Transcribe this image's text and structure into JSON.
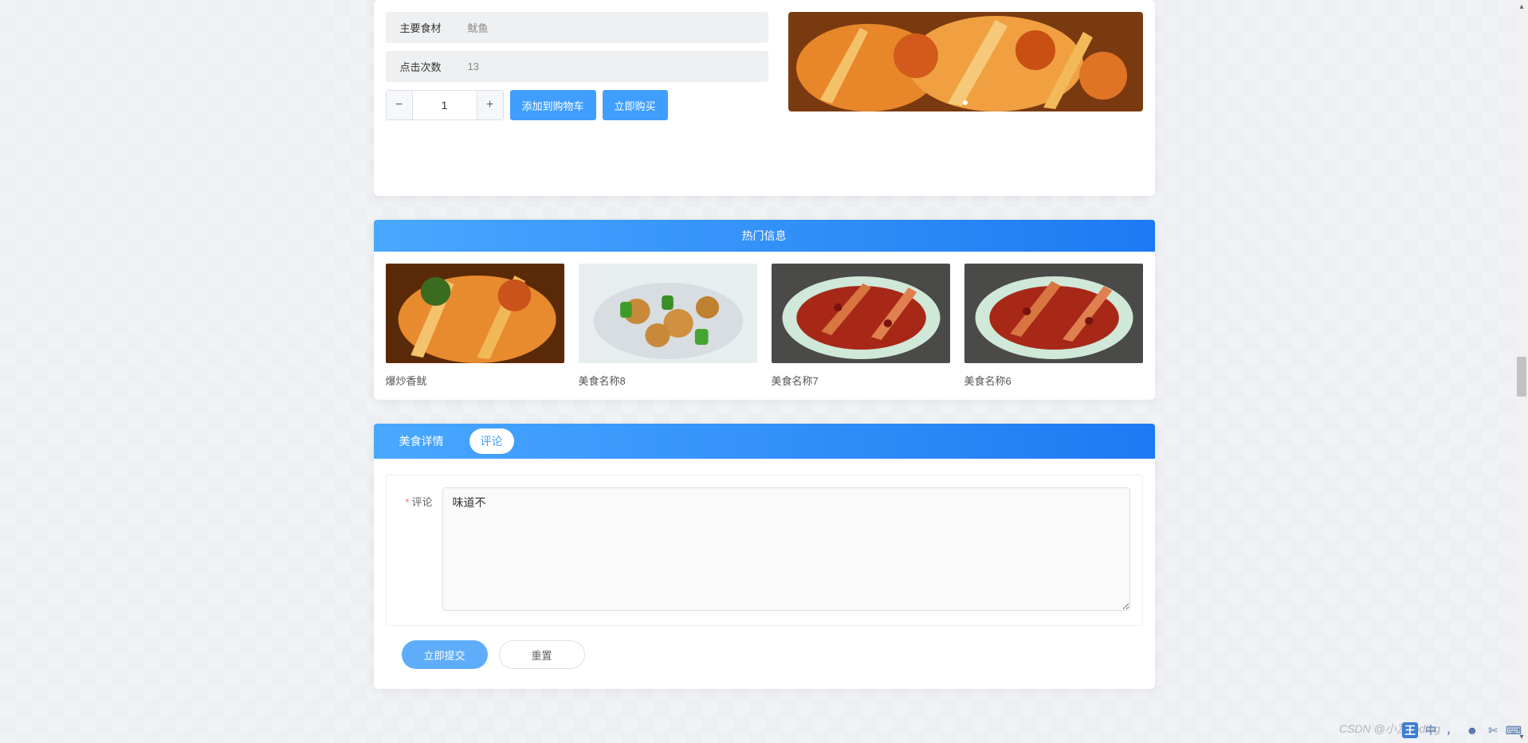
{
  "detail": {
    "ingredient_label": "主要食材",
    "ingredient_value": "鱿鱼",
    "clicks_label": "点击次数",
    "clicks_value": "13",
    "qty": "1",
    "add_cart": "添加到购物车",
    "buy_now": "立即购买"
  },
  "hot": {
    "title": "热门信息",
    "items": [
      {
        "name": "爆炒香鱿"
      },
      {
        "name": "美食名称8"
      },
      {
        "name": "美食名称7"
      },
      {
        "name": "美食名称6"
      }
    ]
  },
  "tabs": {
    "detail": "美食详情",
    "comment": "评论"
  },
  "form": {
    "label": "评论",
    "value": "味道不",
    "submit": "立即提交",
    "reset": "重置"
  },
  "watermark": "CSDN @小芨coding",
  "ime": {
    "first": "王",
    "lang": "中"
  }
}
